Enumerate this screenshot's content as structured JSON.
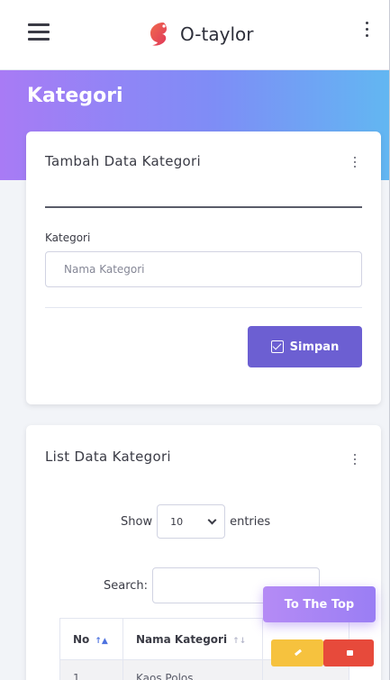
{
  "brand": {
    "name": "O-taylor"
  },
  "hero": {
    "title": "Kategori"
  },
  "form_card": {
    "title": "Tambah Data Kategori",
    "field_label": "Kategori",
    "field_placeholder": "Nama Kategori",
    "field_value": "",
    "submit_label": "Simpan"
  },
  "list_card": {
    "title": "List Data Kategori",
    "show_label": "Show",
    "entries_value": "10",
    "entries_label": "entries",
    "search_label": "Search:",
    "search_value": "",
    "columns": [
      "No",
      "Nama Kategori"
    ],
    "rows": [
      {
        "no": "1",
        "name": "Kaos Polos"
      }
    ]
  },
  "to_top_label": "To The Top",
  "colors": {
    "primary_button": "#6c5fd2",
    "edit_button": "#f6c23e",
    "delete_button": "#e74a3b",
    "hero_gradient_start": "#a87bf5",
    "hero_gradient_end": "#62b7f2"
  },
  "icons": [
    "menu-icon",
    "brand-logo-icon",
    "kebab-menu-icon",
    "check-square-icon",
    "sort-icon",
    "edit-icon",
    "trash-icon"
  ]
}
